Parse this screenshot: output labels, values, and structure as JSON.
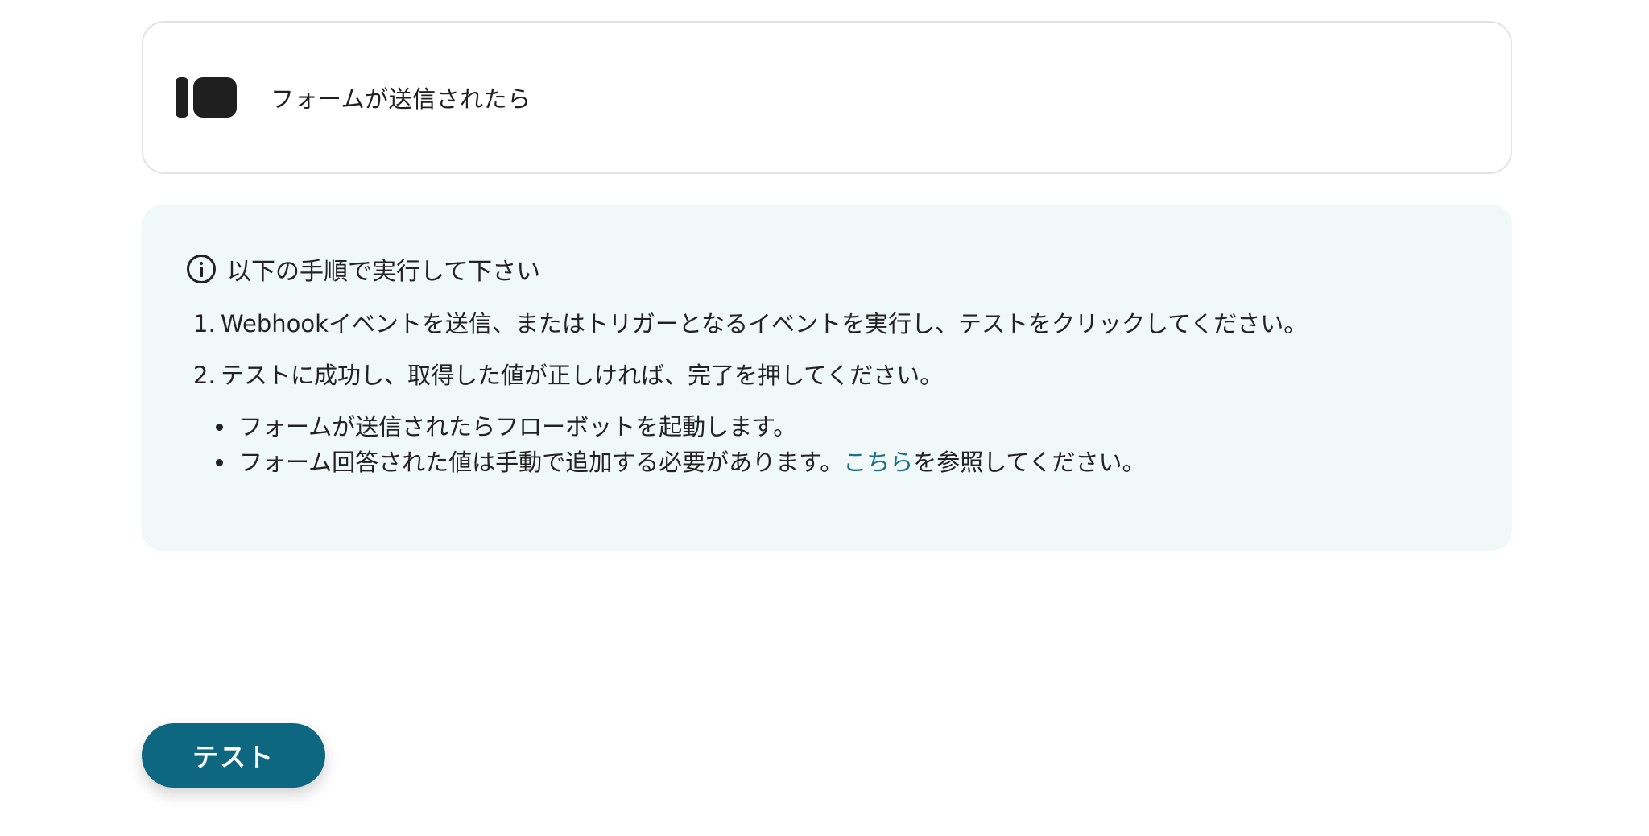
{
  "trigger": {
    "icon": "form-icon",
    "label": "フォームが送信されたら"
  },
  "info_panel": {
    "icon": "info-icon",
    "heading": "以下の手順で実行して下さい",
    "steps": [
      {
        "number": "1.",
        "text": "Webhookイベントを送信、またはトリガーとなるイベントを実行し、テストをクリックしてください。"
      },
      {
        "number": "2.",
        "text": "テストに成功し、取得した値が正しければ、完了を押してください。"
      }
    ],
    "notes": [
      {
        "text": "フォームが送信されたらフローボットを起動します。"
      },
      {
        "text_before": "フォーム回答された値は手動で追加する必要があります。",
        "link_text": "こちら",
        "text_after": "を参照してください。"
      }
    ]
  },
  "actions": {
    "test_label": "テスト"
  },
  "colors": {
    "accent": "#0d6780",
    "link": "#1a6e8a",
    "panel_background": "#f1f9f8",
    "card_border": "#e3e3e3"
  }
}
